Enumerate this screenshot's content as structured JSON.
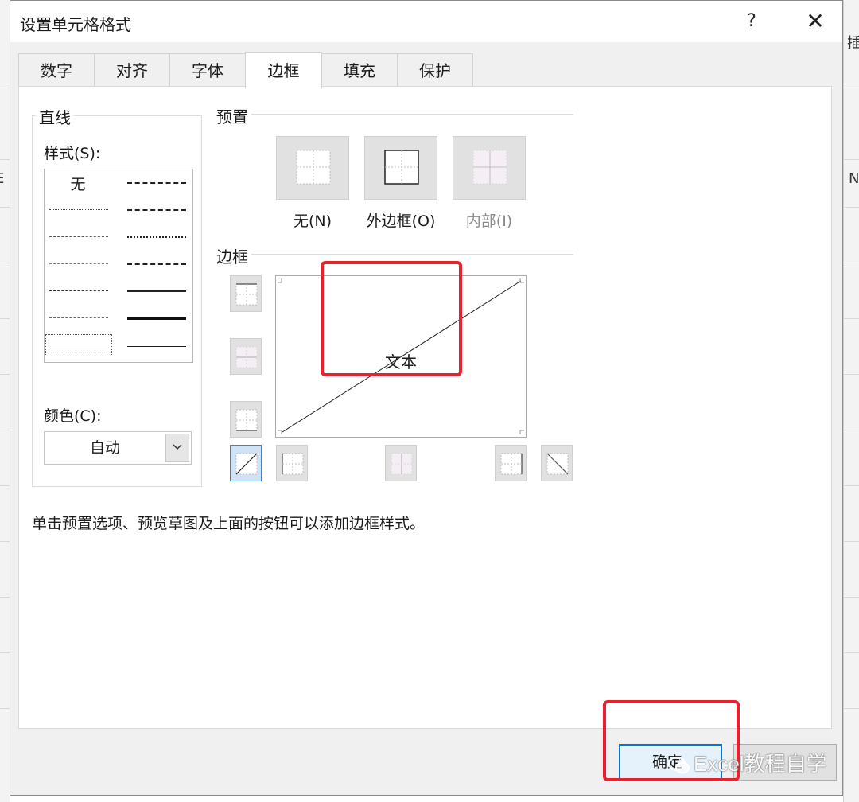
{
  "dialog": {
    "title": "设置单元格格式",
    "help_label": "?",
    "close_label": "✕"
  },
  "tabs": [
    {
      "label": "数字",
      "active": false
    },
    {
      "label": "对齐",
      "active": false
    },
    {
      "label": "字体",
      "active": false
    },
    {
      "label": "边框",
      "active": true
    },
    {
      "label": "填充",
      "active": false
    },
    {
      "label": "保护",
      "active": false
    }
  ],
  "line": {
    "group_label": "直线",
    "style_label": "样式(S):",
    "none_label": "无",
    "color_label": "颜色(C):",
    "color_value": "自动"
  },
  "presets": {
    "section_label": "预置",
    "items": [
      {
        "label": "无(N)",
        "icon": "preset-none-icon",
        "enabled": true
      },
      {
        "label": "外边框(O)",
        "icon": "preset-outline-icon",
        "enabled": true
      },
      {
        "label": "内部(I)",
        "icon": "preset-inside-icon",
        "enabled": false
      }
    ]
  },
  "border": {
    "section_label": "边框",
    "preview_text": "文本"
  },
  "hint": "单击预置选项、预览草图及上面的按钮可以添加边框样式。",
  "buttons": {
    "ok_label": "确定"
  },
  "watermark": "Excel教程自学",
  "background_chars": {
    "c1": "插",
    "c2": "N",
    "c3": "E"
  },
  "colors": {
    "accent": "#0078d7",
    "annotation": "#e8212e"
  }
}
